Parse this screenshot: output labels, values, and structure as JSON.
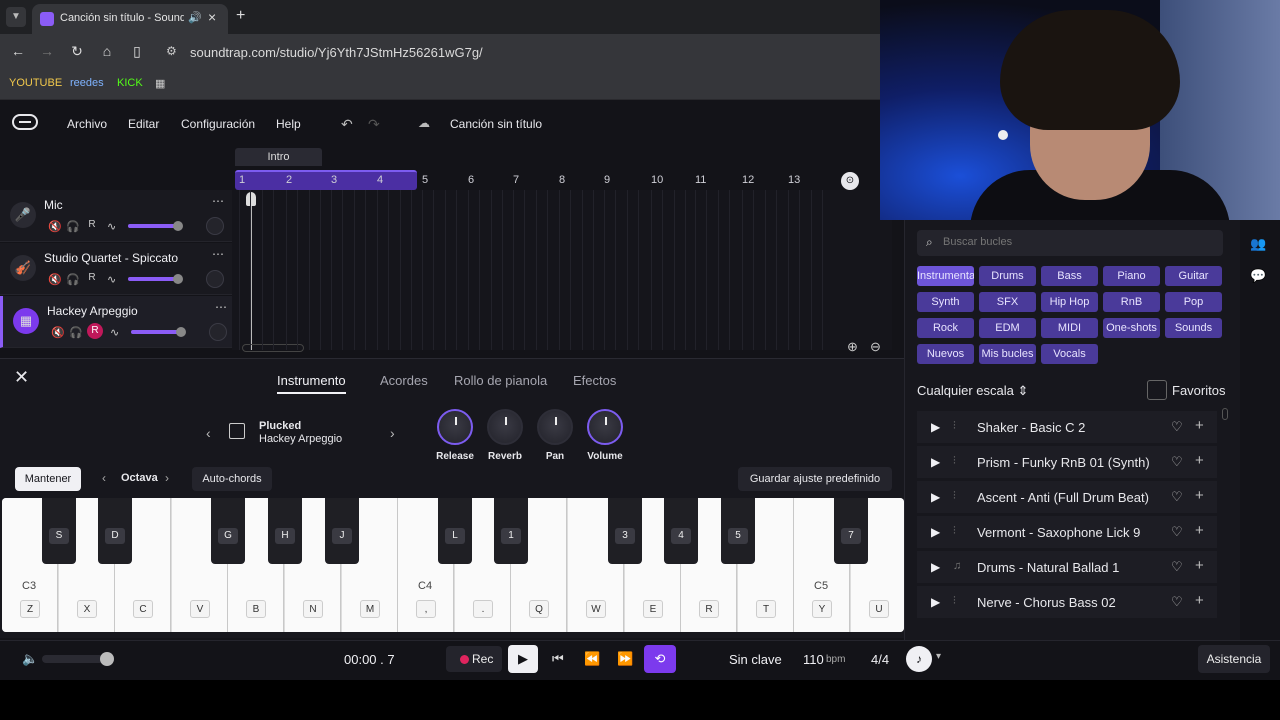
{
  "browser": {
    "tab_title": "Canción sin título - Soundtrap",
    "url": "soundtrap.com/studio/Yj6Yth7JStmHz56261wG7g/",
    "bookmarks": [
      {
        "label": "YOUTUBE",
        "color": "#f2c94c"
      },
      {
        "label": "reedes",
        "color": "#7fb3ff"
      },
      {
        "label": "KICK",
        "color": "#53fc18"
      }
    ]
  },
  "menubar": {
    "items": [
      "Archivo",
      "Editar",
      "Configuración",
      "Help"
    ],
    "song_title": "Canción sin título"
  },
  "timeline": {
    "section_label": "Intro",
    "bar_numbers": [
      "1",
      "2",
      "3",
      "4",
      "5",
      "6",
      "7",
      "8",
      "9",
      "10",
      "11",
      "12",
      "13"
    ],
    "loop_bars": 4
  },
  "tracks": [
    {
      "name": "Mic",
      "icon": "mic-icon",
      "rec": "R",
      "volume": 0.93,
      "selected": false,
      "armed": false
    },
    {
      "name": "Studio Quartet - Spiccato",
      "icon": "strings-icon",
      "rec": "R",
      "volume": 0.93,
      "selected": false,
      "armed": false
    },
    {
      "name": "Hackey Arpeggio",
      "icon": "keyboard-icon",
      "rec": "R",
      "volume": 0.93,
      "selected": true,
      "armed": true
    }
  ],
  "instrument_panel": {
    "tabs": [
      "Instrumento",
      "Acordes",
      "Rollo de pianola",
      "Efectos"
    ],
    "active_tab": "Instrumento",
    "preset_line1": "Plucked",
    "preset_line2": "Hackey Arpeggio",
    "knobs": [
      "Release",
      "Reverb",
      "Pan",
      "Volume"
    ],
    "keep_label": "Mantener",
    "octave_label": "Octava",
    "autochords_label": "Auto-chords",
    "save_preset_label": "Guardar ajuste predefinido"
  },
  "keyboard": {
    "white_keys": [
      "Z",
      "X",
      "C",
      "V",
      "B",
      "N",
      "M",
      ",",
      ".",
      "Q",
      "W",
      "E",
      "R",
      "T",
      "Y",
      "U"
    ],
    "black_keys": [
      {
        "label": "S",
        "after": 0
      },
      {
        "label": "D",
        "after": 1
      },
      {
        "label": "G",
        "after": 3
      },
      {
        "label": "H",
        "after": 4
      },
      {
        "label": "J",
        "after": 5
      },
      {
        "label": "L",
        "after": 7
      },
      {
        "label": "1",
        "after": 8
      },
      {
        "label": "3",
        "after": 10
      },
      {
        "label": "4",
        "after": 11
      },
      {
        "label": "5",
        "after": 12
      },
      {
        "label": "7",
        "after": 14
      }
    ],
    "note_labels": [
      {
        "label": "C3",
        "key": 0
      },
      {
        "label": "C4",
        "key": 7
      },
      {
        "label": "C5",
        "key": 14
      }
    ]
  },
  "transport": {
    "timecode": "00:00 . 7",
    "rec_label": "Rec",
    "key_label": "Sin clave",
    "bpm": "110",
    "bpm_unit": "bpm",
    "time_signature": "4/4",
    "assist_label": "Asistencia",
    "master_volume": 0.85
  },
  "loops": {
    "search_placeholder": "Buscar bucles",
    "chips": [
      "Instrumental",
      "Drums",
      "Bass",
      "Piano",
      "Guitar",
      "Synth",
      "SFX",
      "Hip Hop",
      "RnB",
      "Pop",
      "Rock",
      "EDM",
      "MIDI",
      "One-shots",
      "Sounds",
      "Nuevos",
      "Mis bucles",
      "Vocals"
    ],
    "active_chip": "Instrumental",
    "scale_label": "Cualquier escala",
    "favorites_label": "Favoritos",
    "items": [
      {
        "name": "Shaker - Basic C 2",
        "type": "audio"
      },
      {
        "name": "Prism - Funky RnB 01 (Synth)",
        "type": "audio"
      },
      {
        "name": "Ascent - Anti (Full Drum Beat)",
        "type": "audio"
      },
      {
        "name": "Vermont - Saxophone Lick 9",
        "type": "audio"
      },
      {
        "name": "Drums - Natural Ballad 1",
        "type": "midi"
      },
      {
        "name": "Nerve - Chorus Bass 02",
        "type": "audio"
      }
    ]
  },
  "colors": {
    "accent": "#7c3aed",
    "chip": "#4a3a9a",
    "armed_rec": "#c0185a"
  }
}
